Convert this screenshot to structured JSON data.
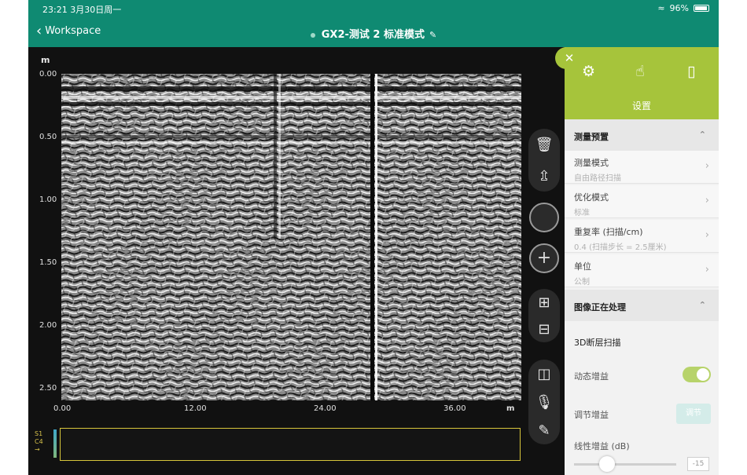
{
  "status": {
    "time": "23:21  3月30日周一",
    "battery": "96%"
  },
  "nav": {
    "back_label": "Workspace",
    "title": "GX2-测试 2 标准模式"
  },
  "radar": {
    "depth_unit": "m",
    "depth_ticks": [
      "0.00",
      "0.50",
      "1.00",
      "1.50",
      "2.00",
      "2.50"
    ],
    "distance_ticks": [
      "0.00",
      "12.00",
      "24.00",
      "36.00"
    ],
    "distance_unit": "m"
  },
  "strip": {
    "labels": [
      "S1",
      "C4",
      "→"
    ]
  },
  "panel": {
    "tab_settings_label": "设置",
    "section1": {
      "title": "测量预置",
      "rows": [
        {
          "title": "测量模式",
          "value": "自由路径扫描"
        },
        {
          "title": "优化模式",
          "value": "标准"
        },
        {
          "title": "重复率 (扫描/cm)",
          "value": "0.4 (扫描步长 = 2.5厘米)"
        },
        {
          "title": "单位",
          "value": "公制"
        }
      ]
    },
    "section2": {
      "title": "图像正在处理",
      "tomography": "3D断层扫描",
      "dynamic_gain": "动态增益",
      "adjust_gain": "调节增益",
      "adjust_gain_btn": "调节",
      "linear_gain": "线性增益 (dB)",
      "linear_gain_value": "-15"
    }
  },
  "colors": {
    "nav": "#0f8a72",
    "accent": "#a6c43b",
    "strip_border": "#d8c63b"
  }
}
